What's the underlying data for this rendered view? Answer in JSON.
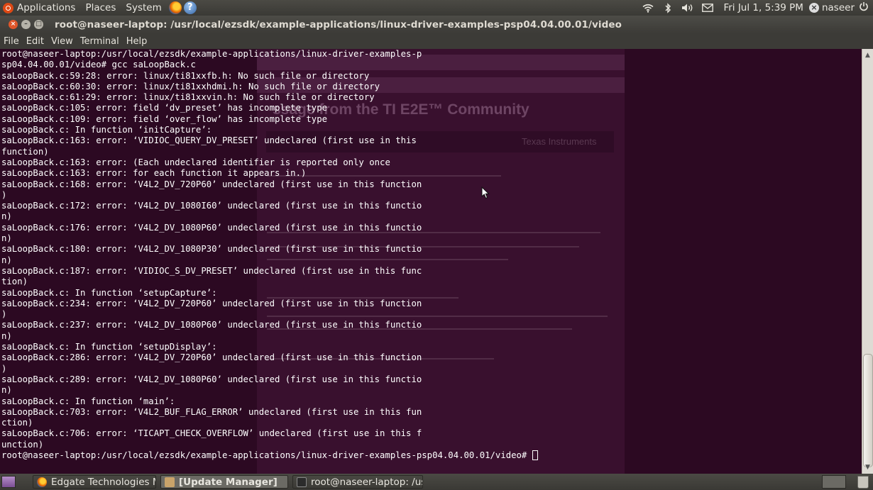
{
  "top_panel": {
    "menus": [
      "Applications",
      "Places",
      "System"
    ],
    "clock": "Fri Jul  1,  5:39 PM",
    "user": "naseer"
  },
  "window": {
    "title": "root@naseer-laptop: /usr/local/ezsdk/example-applications/linux-driver-examples-psp04.04.00.01/video",
    "menus": [
      "File",
      "Edit",
      "View",
      "Terminal",
      "Help"
    ]
  },
  "terminal": {
    "lines": [
      "root@naseer-laptop:/usr/local/ezsdk/example-applications/linux-driver-examples-p",
      "sp04.04.00.01/video# gcc saLoopBack.c",
      "saLoopBack.c:59:28: error: linux/ti81xxfb.h: No such file or directory",
      "saLoopBack.c:60:30: error: linux/ti81xxhdmi.h: No such file or directory",
      "saLoopBack.c:61:29: error: linux/ti81xxvin.h: No such file or directory",
      "saLoopBack.c:105: error: field ‘dv_preset’ has incomplete type",
      "saLoopBack.c:109: error: field ‘over_flow’ has incomplete type",
      "saLoopBack.c: In function ‘initCapture’:",
      "saLoopBack.c:163: error: ‘VIDIOC_QUERY_DV_PRESET’ undeclared (first use in this",
      "function)",
      "saLoopBack.c:163: error: (Each undeclared identifier is reported only once",
      "saLoopBack.c:163: error: for each function it appears in.)",
      "saLoopBack.c:168: error: ‘V4L2_DV_720P60’ undeclared (first use in this function",
      ")",
      "saLoopBack.c:172: error: ‘V4L2_DV_1080I60’ undeclared (first use in this functio",
      "n)",
      "saLoopBack.c:176: error: ‘V4L2_DV_1080P60’ undeclared (first use in this functio",
      "n)",
      "saLoopBack.c:180: error: ‘V4L2_DV_1080P30’ undeclared (first use in this functio",
      "n)",
      "saLoopBack.c:187: error: ‘VIDIOC_S_DV_PRESET’ undeclared (first use in this func",
      "tion)",
      "saLoopBack.c: In function ‘setupCapture’:",
      "saLoopBack.c:234: error: ‘V4L2_DV_720P60’ undeclared (first use in this function",
      ")",
      "saLoopBack.c:237: error: ‘V4L2_DV_1080P60’ undeclared (first use in this functio",
      "n)",
      "saLoopBack.c: In function ‘setupDisplay’:",
      "saLoopBack.c:286: error: ‘V4L2_DV_720P60’ undeclared (first use in this function",
      ")",
      "saLoopBack.c:289: error: ‘V4L2_DV_1080P60’ undeclared (first use in this functio",
      "n)",
      "saLoopBack.c: In function ‘main’:",
      "saLoopBack.c:703: error: ‘V4L2_BUF_FLAG_ERROR’ undeclared (first use in this fun",
      "ction)",
      "saLoopBack.c:706: error: ‘TICAPT_CHECK_OVERFLOW’ undeclared (first use in this f",
      "unction)"
    ],
    "prompt": "root@naseer-laptop:/usr/local/ezsdk/example-applications/linux-driver-examples-psp04.04.00.01/video# "
  },
  "background_browser": {
    "heading": "ssage from the TI E2E™ Community",
    "logo_text": "Texas Instruments"
  },
  "taskbar": {
    "tasks": [
      "Edgate Technologies M...",
      "[Update Manager]",
      "root@naseer-laptop: /us..."
    ]
  },
  "colors": {
    "terminal_bg": "#2c0922",
    "terminal_fg": "#ffffff",
    "panel_bg": "#3c3b37",
    "close_button": "#e0562a"
  },
  "icons": [
    "ubuntu-logo-icon",
    "firefox-icon",
    "help-icon",
    "wifi-icon",
    "bluetooth-icon",
    "volume-icon",
    "mail-icon",
    "user-icon",
    "power-icon",
    "trash-icon"
  ]
}
